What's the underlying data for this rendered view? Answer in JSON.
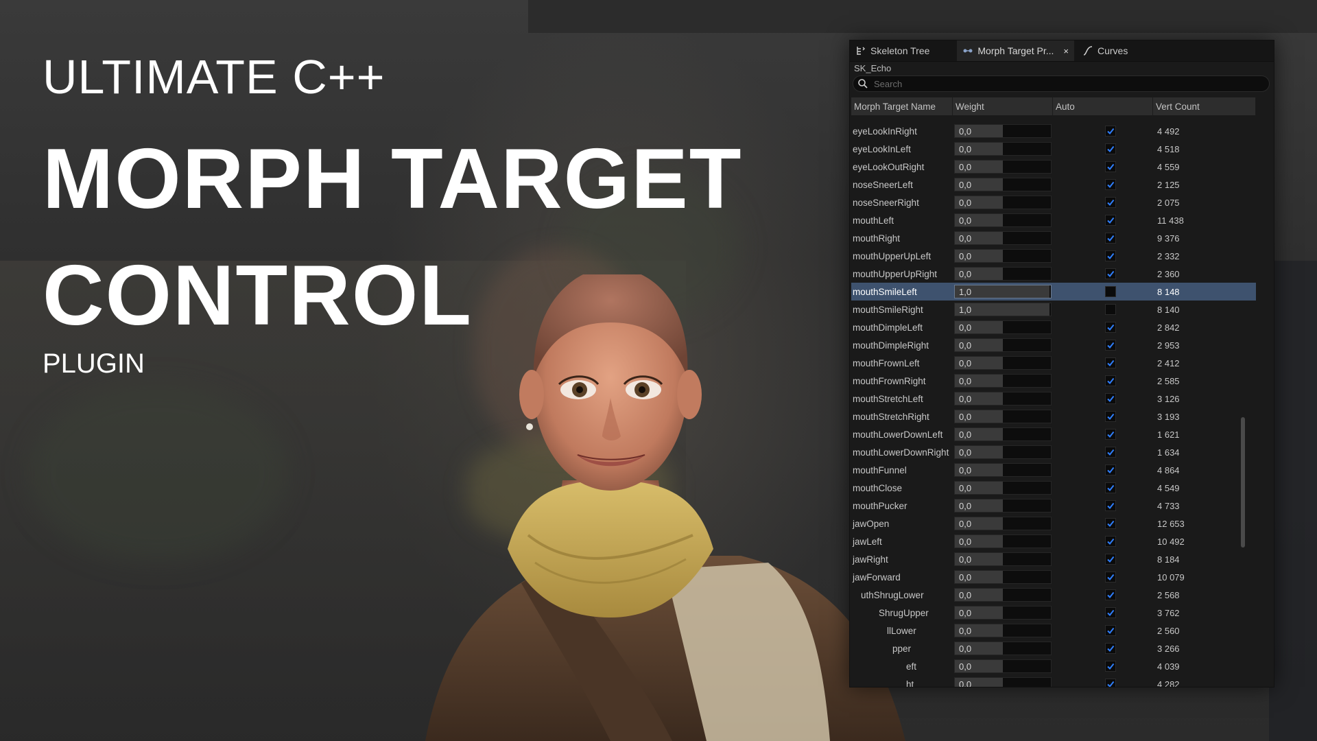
{
  "title": {
    "line1": "ULTIMATE C++",
    "line2": "MORPH TARGET",
    "line3": "CONTROL",
    "line4": "PLUGIN"
  },
  "panel": {
    "tabs": [
      {
        "label": "Skeleton Tree",
        "icon": "skeleton-tree-icon"
      },
      {
        "label": "Morph Target Pr...",
        "icon": "morph-target-icon",
        "close": "×"
      },
      {
        "label": "Curves",
        "icon": "curve-icon"
      }
    ],
    "asset_name": "SK_Echo",
    "search_placeholder": "Search",
    "columns": [
      "Morph Target Name",
      "Weight",
      "Auto",
      "Vert Count"
    ],
    "rows": [
      {
        "name": "eyeLookInRight",
        "weight": "0,0",
        "auto": true,
        "vert": "4 492"
      },
      {
        "name": "eyeLookInLeft",
        "weight": "0,0",
        "auto": true,
        "vert": "4 518"
      },
      {
        "name": "eyeLookOutRight",
        "weight": "0,0",
        "auto": true,
        "vert": "4 559"
      },
      {
        "name": "noseSneerLeft",
        "weight": "0,0",
        "auto": true,
        "vert": "2 125"
      },
      {
        "name": "noseSneerRight",
        "weight": "0,0",
        "auto": true,
        "vert": "2 075"
      },
      {
        "name": "mouthLeft",
        "weight": "0,0",
        "auto": true,
        "vert": "11 438"
      },
      {
        "name": "mouthRight",
        "weight": "0,0",
        "auto": true,
        "vert": "9 376"
      },
      {
        "name": "mouthUpperUpLeft",
        "weight": "0,0",
        "auto": true,
        "vert": "2 332"
      },
      {
        "name": "mouthUpperUpRight",
        "weight": "0,0",
        "auto": true,
        "vert": "2 360"
      },
      {
        "name": "mouthSmileLeft",
        "weight": "1,0",
        "auto": false,
        "vert": "8 148",
        "selected": true
      },
      {
        "name": "mouthSmileRight",
        "weight": "1,0",
        "auto": false,
        "vert": "8 140"
      },
      {
        "name": "mouthDimpleLeft",
        "weight": "0,0",
        "auto": true,
        "vert": "2 842"
      },
      {
        "name": "mouthDimpleRight",
        "weight": "0,0",
        "auto": true,
        "vert": "2 953"
      },
      {
        "name": "mouthFrownLeft",
        "weight": "0,0",
        "auto": true,
        "vert": "2 412"
      },
      {
        "name": "mouthFrownRight",
        "weight": "0,0",
        "auto": true,
        "vert": "2 585"
      },
      {
        "name": "mouthStretchLeft",
        "weight": "0,0",
        "auto": true,
        "vert": "3 126"
      },
      {
        "name": "mouthStretchRight",
        "weight": "0,0",
        "auto": true,
        "vert": "3 193"
      },
      {
        "name": "mouthLowerDownLeft",
        "weight": "0,0",
        "auto": true,
        "vert": "1 621"
      },
      {
        "name": "mouthLowerDownRight",
        "weight": "0,0",
        "auto": true,
        "vert": "1 634"
      },
      {
        "name": "mouthFunnel",
        "weight": "0,0",
        "auto": true,
        "vert": "4 864"
      },
      {
        "name": "mouthClose",
        "weight": "0,0",
        "auto": true,
        "vert": "4 549"
      },
      {
        "name": "mouthPucker",
        "weight": "0,0",
        "auto": true,
        "vert": "4 733"
      },
      {
        "name": "jawOpen",
        "weight": "0,0",
        "auto": true,
        "vert": "12 653"
      },
      {
        "name": "jawLeft",
        "weight": "0,0",
        "auto": true,
        "vert": "10 492"
      },
      {
        "name": "jawRight",
        "weight": "0,0",
        "auto": true,
        "vert": "8 184"
      },
      {
        "name": "jawForward",
        "weight": "0,0",
        "auto": true,
        "vert": "10 079"
      },
      {
        "name": "uthShrugLower",
        "weight": "0,0",
        "auto": true,
        "vert": "2 568"
      },
      {
        "name": "ShrugUpper",
        "weight": "0,0",
        "auto": true,
        "vert": "3 762"
      },
      {
        "name": "llLower",
        "weight": "0,0",
        "auto": true,
        "vert": "2 560"
      },
      {
        "name": "pper",
        "weight": "0,0",
        "auto": true,
        "vert": "3 266"
      },
      {
        "name": "eft",
        "weight": "0,0",
        "auto": true,
        "vert": "4 039"
      },
      {
        "name": "ht",
        "weight": "0,0",
        "auto": true,
        "vert": "4 282"
      }
    ],
    "colors": {
      "selection": "#3e526e",
      "checkbox": "#2f7fff"
    }
  }
}
